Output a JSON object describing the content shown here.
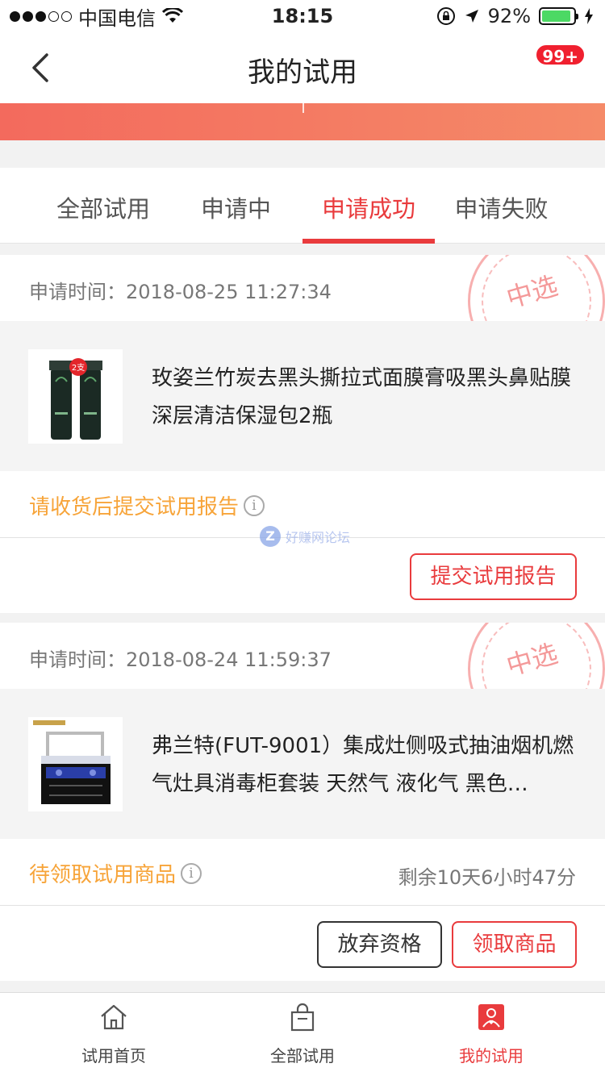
{
  "status_bar": {
    "carrier": "中国电信",
    "time": "18:15",
    "battery": "92%",
    "battery_level": 0.92
  },
  "nav": {
    "title": "我的试用",
    "badge": "99+"
  },
  "tabs": [
    {
      "label": "全部试用"
    },
    {
      "label": "申请中"
    },
    {
      "label": "申请成功"
    },
    {
      "label": "申请失败"
    }
  ],
  "cards": [
    {
      "time": "申请时间：2018-08-25 11:27:34",
      "stamp": "中选",
      "product": "玫姿兰竹炭去黑头撕拉式面膜膏吸黑头鼻贴膜 深层清洁保湿包2瓶",
      "thumb_badge": "2支",
      "status": "请收货后提交试用报告",
      "remain": "",
      "buttons": {
        "primary": "提交试用报告"
      }
    },
    {
      "time": "申请时间：2018-08-24 11:59:37",
      "stamp": "中选",
      "product": "弗兰特(FUT-9001）集成灶侧吸式抽油烟机燃气灶具消毒柜套装 天然气 液化气 黑色…",
      "status": "待领取试用商品",
      "remain": "剩余10天6小时47分",
      "buttons": {
        "secondary": "放弃资格",
        "primary": "领取商品"
      }
    }
  ],
  "watermark": "好赚网论坛",
  "tabbar": [
    {
      "label": "试用首页",
      "icon": "home-icon"
    },
    {
      "label": "全部试用",
      "icon": "bag-icon"
    },
    {
      "label": "我的试用",
      "icon": "my-trial-icon"
    }
  ],
  "colors": {
    "accent": "#e93b3d",
    "status": "#f7a439",
    "banner_start": "#f36a5d",
    "banner_end": "#f58a68"
  }
}
